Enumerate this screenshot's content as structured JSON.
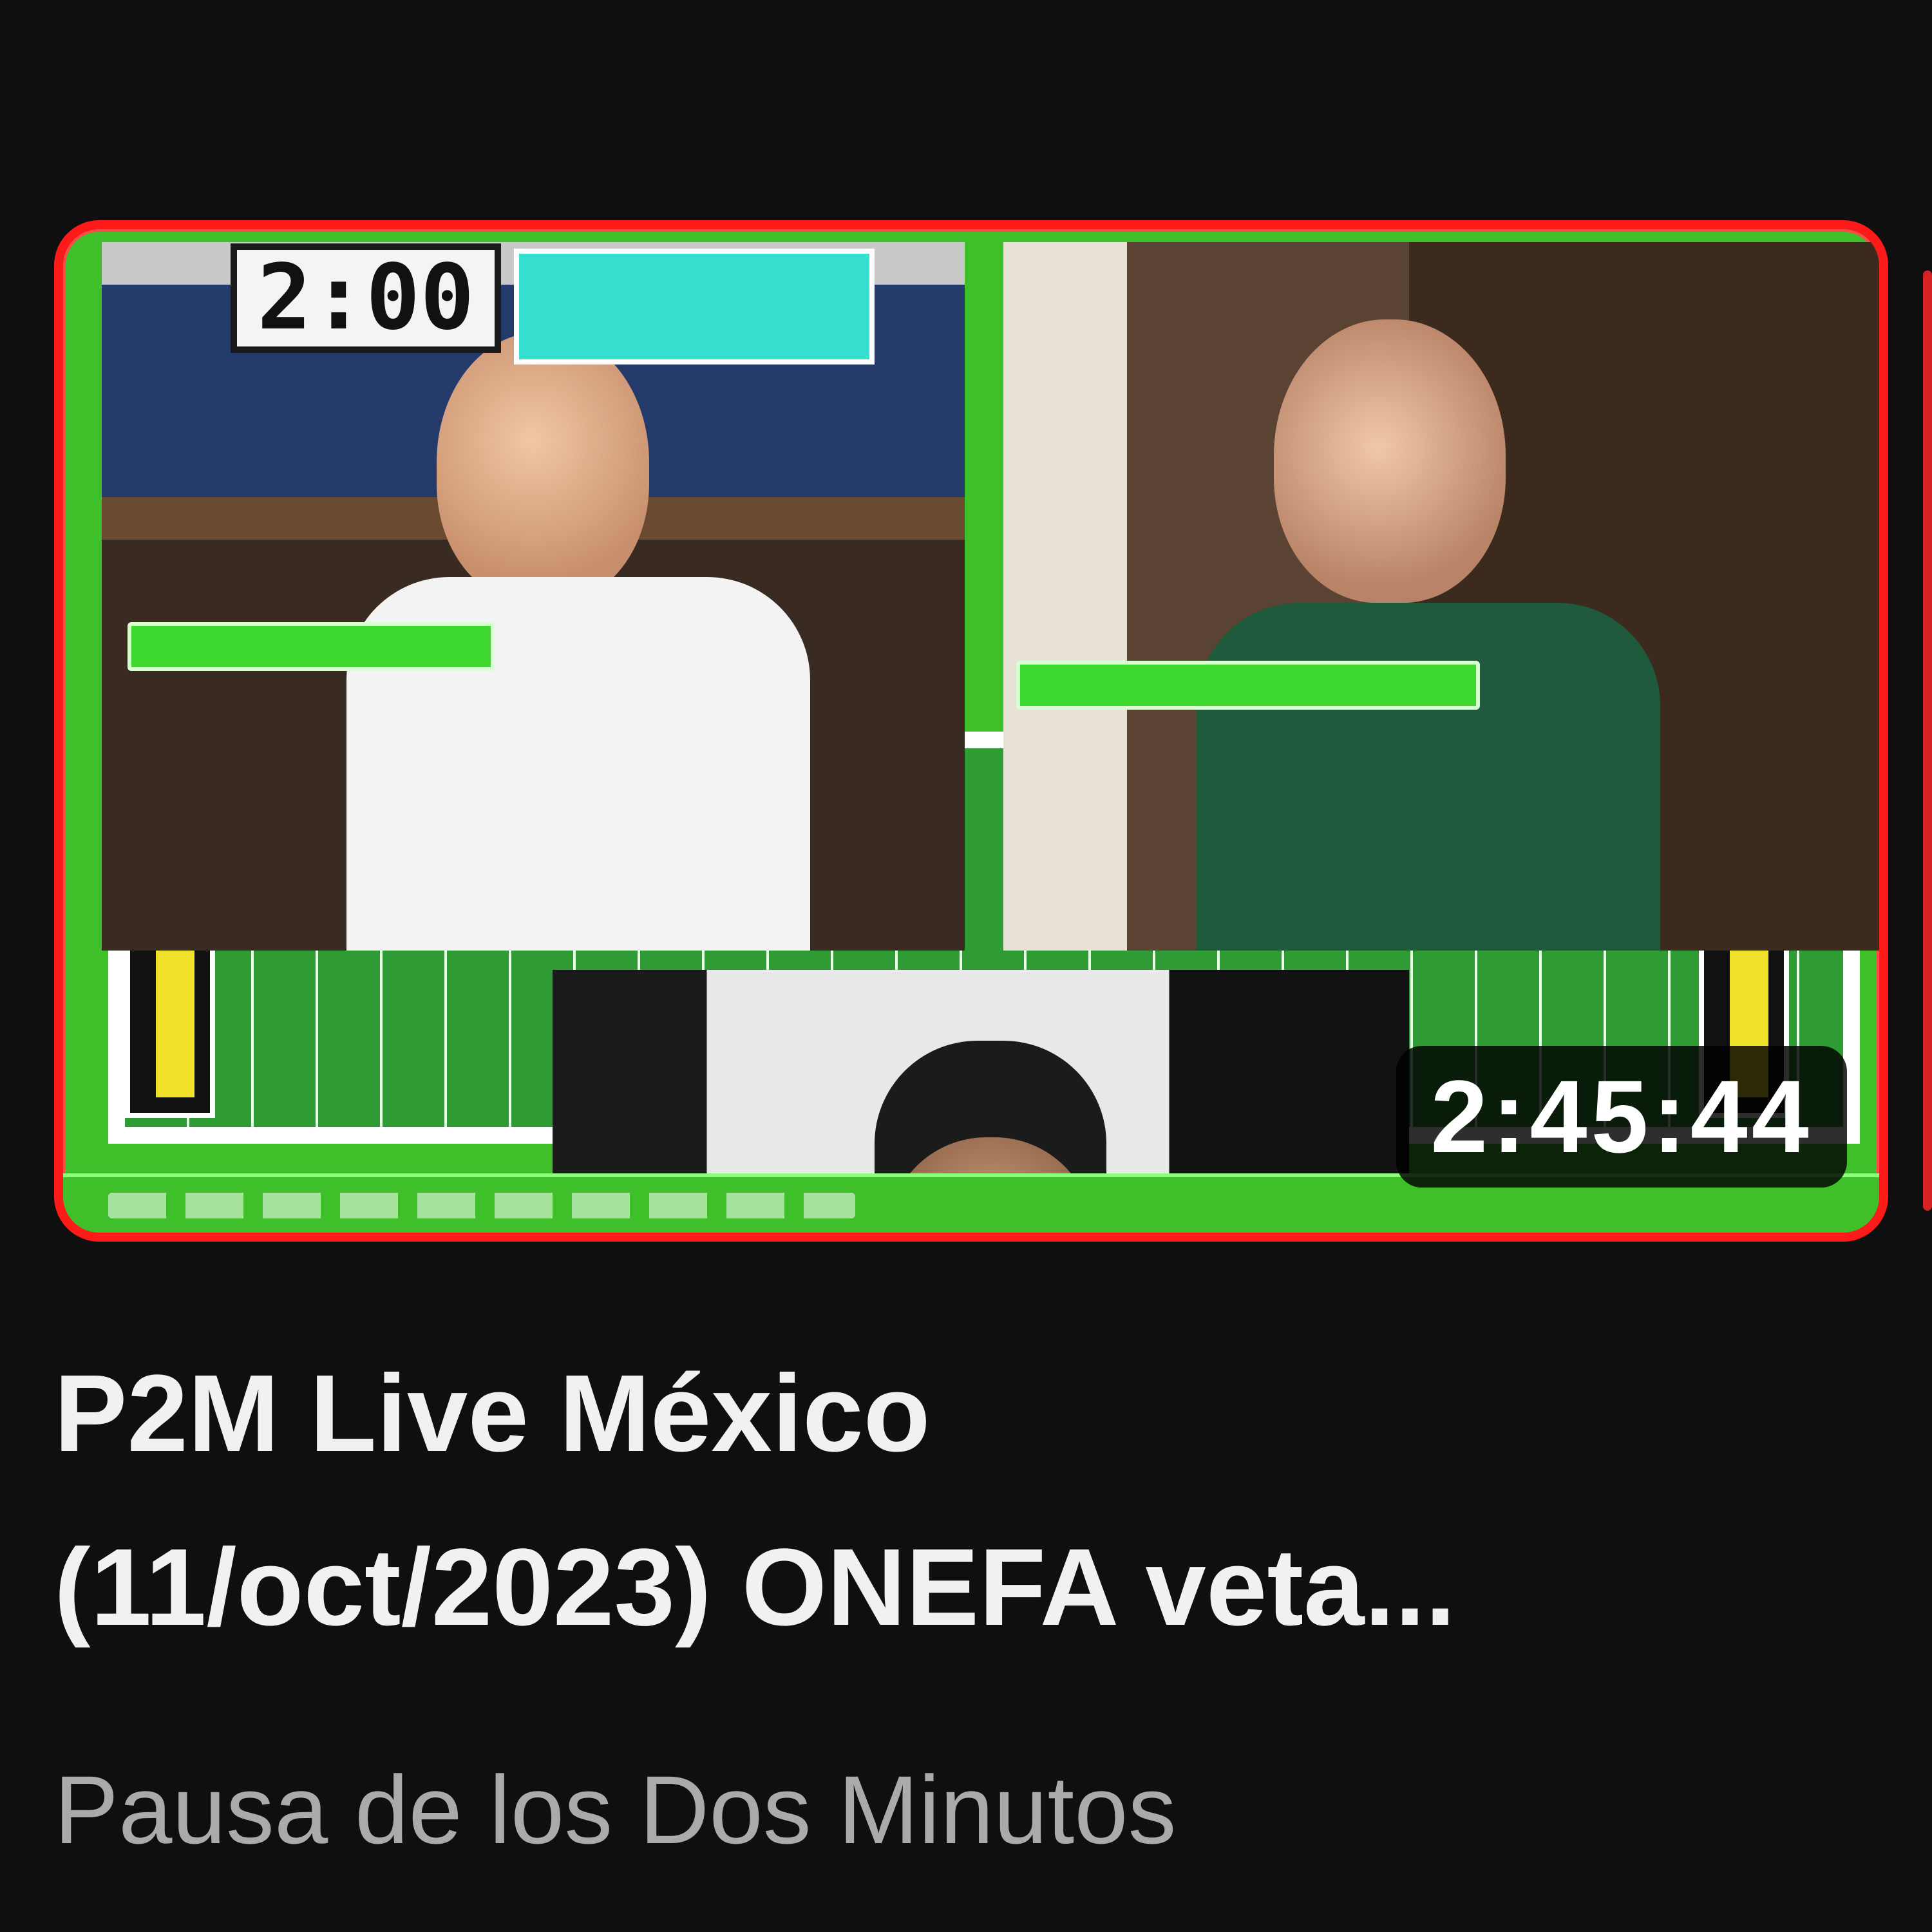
{
  "video": {
    "title_line1": "P2M Live México",
    "title_line2": "(11/oct/2023) ONEFA veta...",
    "channel": "Pausa de los Dos Minutos",
    "duration": "2:45:44",
    "thumbnail": {
      "clock_text": "2:00",
      "accent_red": "#ff1a1a",
      "accent_green": "#3fbf2a",
      "field_green": "#2f9b35"
    }
  }
}
